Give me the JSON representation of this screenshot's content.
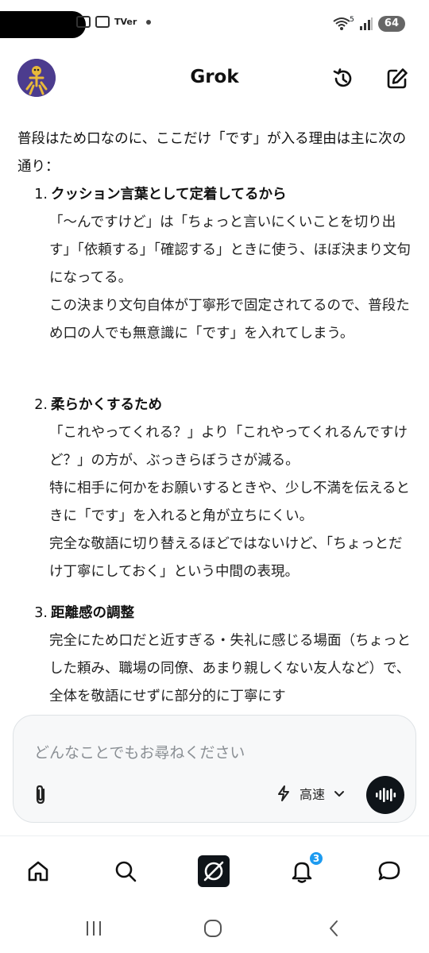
{
  "status_bar": {
    "carrier_text": "TVer",
    "battery": "64",
    "network_badge": "5"
  },
  "header": {
    "title": "Grok"
  },
  "message": {
    "intro": "普段はため口なのに、ここだけ「です」が入る理由は主に次の通り：",
    "sections": [
      {
        "number": "1.",
        "title": "クッション言葉として定着してるから",
        "paragraphs": [
          "「〜んですけど」は「ちょっと言いにくいことを切り出す」「依頼する」「確認する」ときに使う、ほぼ決まり文句になってる。",
          "この決まり文句自体が丁寧形で固定されてるので、普段ため口の人でも無意識に「です」を入れてしまう。"
        ]
      },
      {
        "number": "2.",
        "title": "柔らかくするため",
        "paragraphs": [
          "「これやってくれる？」より「これやってくれるんですけど？」の方が、ぶっきらぼうさが減る。",
          "特に相手に何かをお願いするときや、少し不満を伝えるときに「です」を入れると角が立ちにくい。",
          "完全な敬語に切り替えるほどではないけど、「ちょっとだけ丁寧にしておく」という中間の表現。"
        ]
      },
      {
        "number": "3.",
        "title": "距離感の調整",
        "paragraphs": [
          "完全にため口だと近すぎる・失礼に感じる場面（ちょっとした頼み、職場の同僚、あまり親しくない友人など）で、全体を敬語にせずに部分的に丁寧にす"
        ]
      }
    ]
  },
  "composer": {
    "placeholder": "どんなことでもお尋ねください",
    "mode_label": "高速"
  },
  "bottom_nav": {
    "notification_count": "3"
  },
  "colors": {
    "accent": "#1d9bf0",
    "dark": "#0f1419"
  }
}
